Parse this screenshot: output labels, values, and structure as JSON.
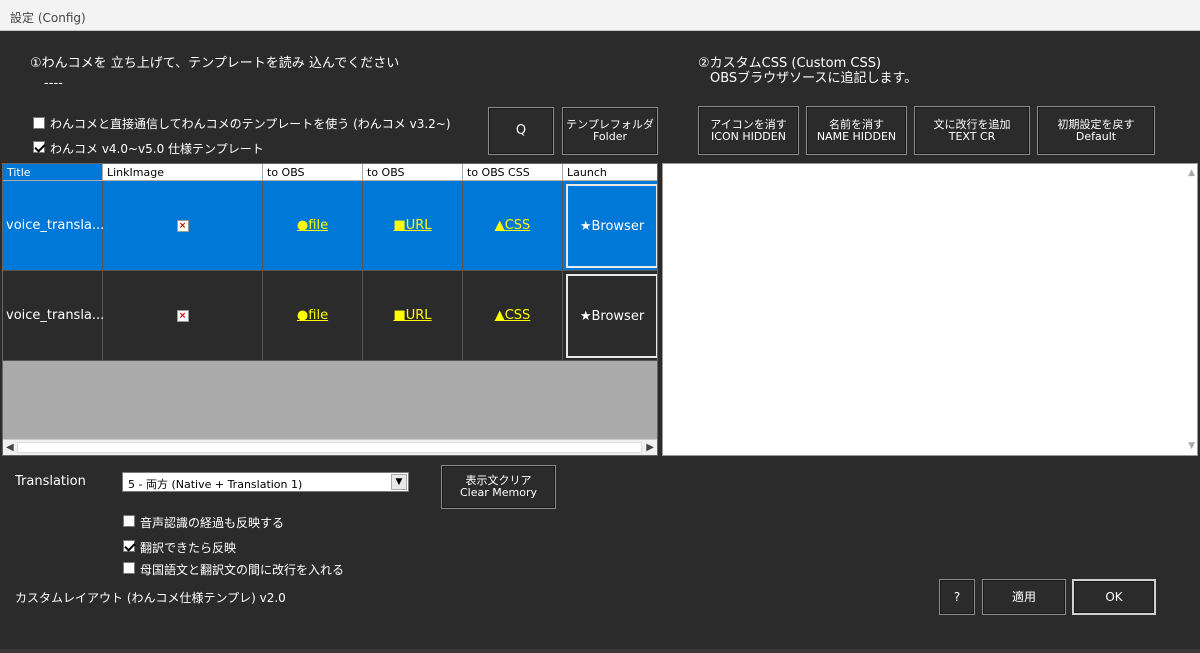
{
  "window": {
    "title": "設定 (Config)"
  },
  "step1": {
    "title": "①わんコメを 立ち上げて、テンプレートを読み 込んでください",
    "dashes": "----"
  },
  "step2": {
    "title": "②カスタムCSS (Custom CSS)",
    "subtitle": "OBSブラウザソースに追記します。"
  },
  "options": [
    {
      "label": "わんコメと直接通信してわんコメのテンプレートを使う (わんコメ v3.2~)",
      "checked": false
    },
    {
      "label": "わんコメ v4.0~v5.0 仕様テンプレート",
      "checked": true
    }
  ],
  "buttons": {
    "q": "Q",
    "folder_jp": "テンプレフォルダ",
    "folder_en": "Folder",
    "icon_jp": "アイコンを消す",
    "icon_en": "ICON HIDDEN",
    "name_jp": "名前を消す",
    "name_en": "NAME HIDDEN",
    "cr_jp": "文に改行を追加",
    "cr_en": "TEXT CR",
    "default_jp": "初期設定を戻す",
    "default_en": "Default",
    "clear_jp": "表示文クリア",
    "clear_en": "Clear Memory",
    "help": "?",
    "apply": "適用",
    "ok": "OK"
  },
  "grid": {
    "headers": [
      "Title",
      "LinkImage",
      "to OBS",
      "to OBS",
      "to OBS CSS",
      "Launch"
    ],
    "rows": [
      {
        "title": "voice_transla...",
        "file": "●file",
        "url": "■URL",
        "css": "▲CSS",
        "launch": "★Browser"
      },
      {
        "title": "voice_transla...",
        "file": "●file",
        "url": "■URL",
        "css": "▲CSS",
        "launch": "★Browser"
      }
    ]
  },
  "translation": {
    "label": "Translation",
    "selected": "5 - 両方 (Native + Translation 1)",
    "checks": [
      {
        "label": "音声認識の経過も反映する",
        "checked": false
      },
      {
        "label": "翻訳できたら反映",
        "checked": true
      },
      {
        "label": "母国語文と翻訳文の間に改行を入れる",
        "checked": false
      }
    ]
  },
  "footer": {
    "version": "カスタムレイアウト (わんコメ仕様テンプレ) v2.0"
  },
  "colors": {
    "background": "#2b2b2b",
    "selected_row": "#0078d7",
    "link": "#ffff00"
  }
}
